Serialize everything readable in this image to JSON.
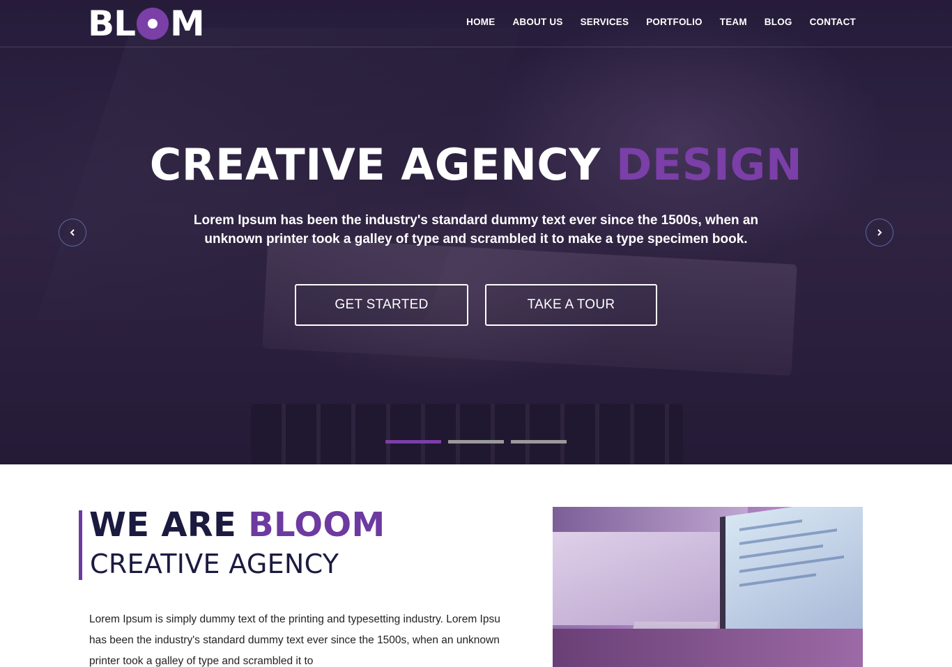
{
  "brand": {
    "logo_text_left": "BL",
    "logo_text_right": "M",
    "accent_color": "#7b3fa8"
  },
  "nav": {
    "items": [
      {
        "label": "HOME"
      },
      {
        "label": "ABOUT US"
      },
      {
        "label": "SERVICES"
      },
      {
        "label": "PORTFOLIO"
      },
      {
        "label": "TEAM"
      },
      {
        "label": "BLOG"
      },
      {
        "label": "CONTACT"
      }
    ]
  },
  "hero": {
    "title_main": "CREATIVE AGENCY",
    "title_accent": "DESIGN",
    "subtitle": "Lorem Ipsum has been the industry's standard dummy text ever since the 1500s, when an unknown printer took a galley of type and scrambled it to make a type specimen book.",
    "btn_primary": "GET STARTED",
    "btn_secondary": "TAKE A TOUR",
    "prev_icon": "chevron-left-icon",
    "next_icon": "chevron-right-icon",
    "slides": {
      "count": 3,
      "active": 1
    }
  },
  "about": {
    "heading_main": "WE ARE",
    "heading_accent": "BLOOM",
    "subheading": "CREATIVE AGENCY",
    "text": "Lorem Ipsum is simply dummy text of the printing and typesetting industry. Lorem Ipsu has been the industry's standard dummy text ever since the 1500s, when an unknown printer took a galley of type and scrambled it to"
  }
}
